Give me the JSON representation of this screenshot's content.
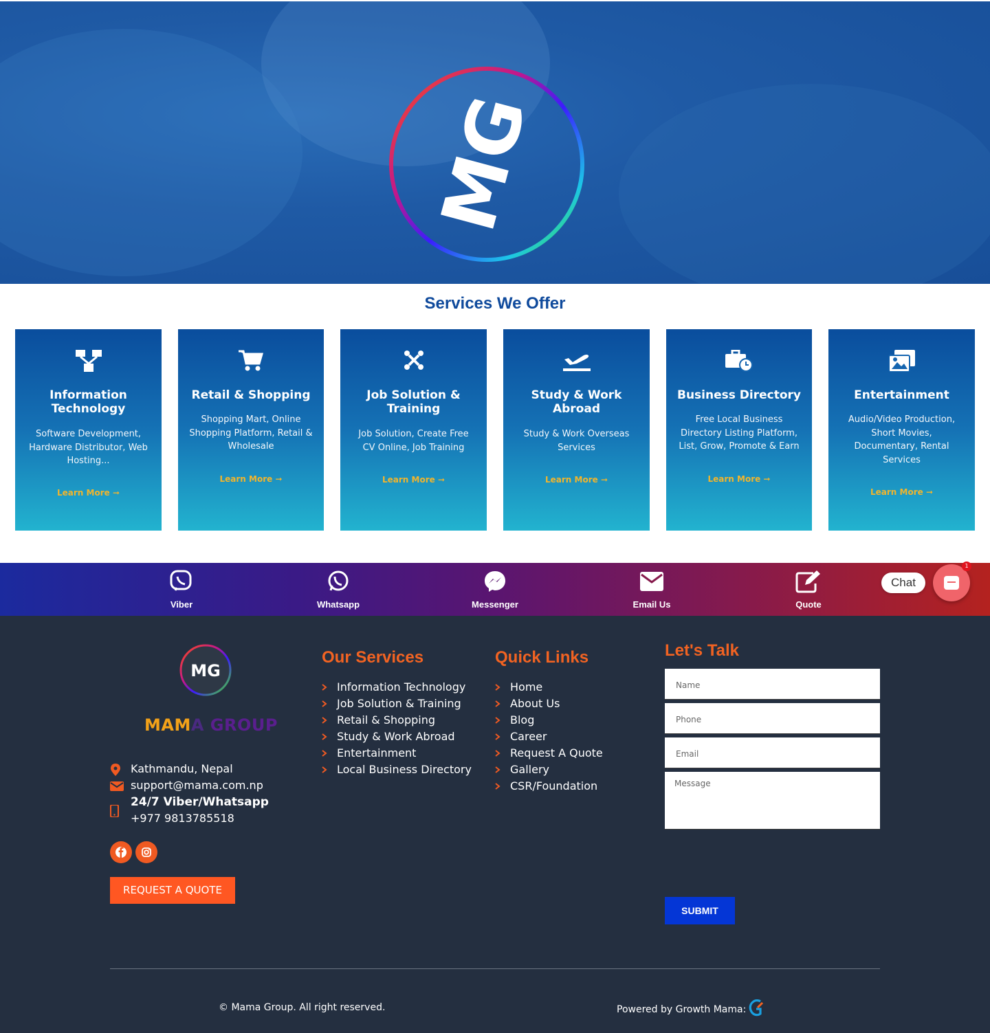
{
  "hero": {
    "logo_letters": "MG"
  },
  "services": {
    "title": "Services We Offer",
    "cards": [
      {
        "icon": "sitemap-icon",
        "title": "Information Technology",
        "desc": "Software Development, Hardware Distributor, Web Hosting...",
        "link": "Learn More"
      },
      {
        "icon": "shopping-cart-icon",
        "title": "Retail & Shopping",
        "desc": "Shopping Mart, Online Shopping Platform, Retail & Wholesale",
        "link": "Learn More"
      },
      {
        "icon": "joomla-icon",
        "title": "Job Solution & Training",
        "desc": "Job Solution, Create Free CV Online, Job Training",
        "link": "Learn More"
      },
      {
        "icon": "plane-departure-icon",
        "title": "Study & Work Abroad",
        "desc": "Study & Work Overseas Services",
        "link": "Learn More"
      },
      {
        "icon": "business-time-icon",
        "title": "Business Directory",
        "desc": "Free Local Business Directory Listing Platform, List, Grow, Promote & Earn",
        "link": "Learn More"
      },
      {
        "icon": "images-icon",
        "title": "Entertainment",
        "desc": "Audio/Video Production, Short Movies, Documentary, Rental Services",
        "link": "Learn More"
      }
    ]
  },
  "contact_bar": {
    "items": [
      "Viber",
      "Whatsapp",
      "Messenger",
      "Email Us",
      "Quote"
    ],
    "chat_label": "Chat",
    "chat_badge": "1"
  },
  "footer": {
    "brand_part1": "MAM",
    "brand_part2": "A",
    "brand_part3": " GROUP",
    "logo_letters": "MG",
    "address": "Kathmandu, Nepal",
    "email": "support@mama.com.np",
    "phone_title": "24/7 Viber/Whatsapp",
    "phone": "+977 9813785518",
    "request_quote": "REQUEST A QUOTE",
    "our_services": {
      "title": "Our Services",
      "items": [
        "Information Technology",
        "Job Solution & Training",
        "Retail & Shopping",
        "Study & Work Abroad",
        "Entertainment",
        "Local Business Directory"
      ]
    },
    "quick_links": {
      "title": "Quick Links",
      "items": [
        "Home",
        "About Us",
        "Blog",
        "Career",
        "Request A Quote",
        "Gallery",
        "CSR/Foundation"
      ]
    },
    "form": {
      "title": "Let's Talk",
      "name_placeholder": "Name",
      "phone_placeholder": "Phone",
      "email_placeholder": "Email",
      "message_placeholder": "Message",
      "submit": "SUBMIT"
    },
    "copyright": "© Mama Group. All right reserved.",
    "powered_by": "Powered by Growth Mama:"
  },
  "colors": {
    "accent_orange": "#f26322",
    "service_blue": "#0f4a9c",
    "submit_blue": "#0436d6",
    "footer_bg": "#242f40",
    "learn_more": "#f2b52c"
  }
}
